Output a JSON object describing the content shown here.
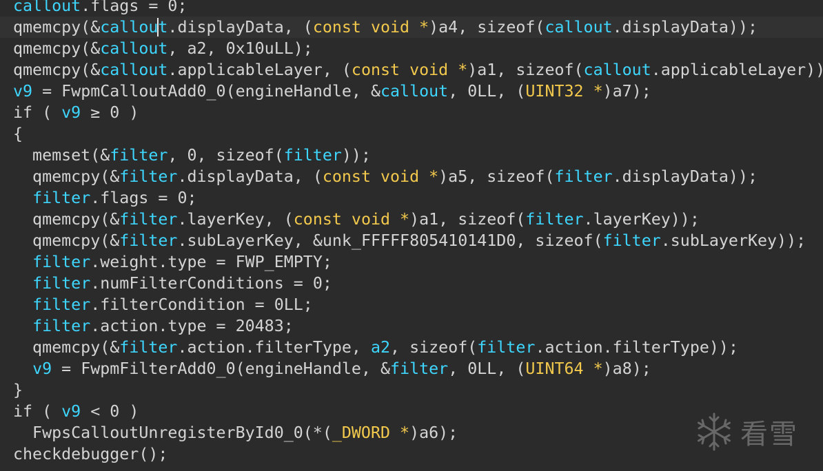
{
  "editor": {
    "lines": [
      [
        {
          "t": "callout",
          "c": "var"
        },
        {
          "t": ".flags = 0;",
          "c": "plain"
        }
      ],
      [
        {
          "t": "qmemcpy(&",
          "c": "plain"
        },
        {
          "t": "callou",
          "c": "var"
        },
        {
          "caret": true
        },
        {
          "t": "t",
          "c": "var"
        },
        {
          "t": ".displayData, (",
          "c": "plain"
        },
        {
          "t": "const void *",
          "c": "type"
        },
        {
          "t": ")a4, sizeof(",
          "c": "plain"
        },
        {
          "t": "callout",
          "c": "var"
        },
        {
          "t": ".displayData));",
          "c": "plain"
        }
      ],
      [
        {
          "t": "qmemcpy(&",
          "c": "plain"
        },
        {
          "t": "callout",
          "c": "var"
        },
        {
          "t": ", a2, 0x10uLL);",
          "c": "plain"
        }
      ],
      [
        {
          "t": "qmemcpy(&",
          "c": "plain"
        },
        {
          "t": "callout",
          "c": "var"
        },
        {
          "t": ".applicableLayer, (",
          "c": "plain"
        },
        {
          "t": "const void *",
          "c": "type"
        },
        {
          "t": ")a1, sizeof(",
          "c": "plain"
        },
        {
          "t": "callout",
          "c": "var"
        },
        {
          "t": ".applicableLayer));",
          "c": "plain"
        }
      ],
      [
        {
          "t": "v9",
          "c": "var"
        },
        {
          "t": " = FwpmCalloutAdd0_0(engineHandle, &",
          "c": "plain"
        },
        {
          "t": "callout",
          "c": "var"
        },
        {
          "t": ", 0LL, (",
          "c": "plain"
        },
        {
          "t": "UINT32 *",
          "c": "type"
        },
        {
          "t": ")a7);",
          "c": "plain"
        }
      ],
      [
        {
          "t": "if ( ",
          "c": "plain"
        },
        {
          "t": "v9",
          "c": "var"
        },
        {
          "t": " ≥ 0 )",
          "c": "plain"
        }
      ],
      [
        {
          "t": "{",
          "c": "plain"
        }
      ],
      [
        {
          "t": "  memset(&",
          "c": "plain"
        },
        {
          "t": "filter",
          "c": "var"
        },
        {
          "t": ", 0, sizeof(",
          "c": "plain"
        },
        {
          "t": "filter",
          "c": "var"
        },
        {
          "t": "));",
          "c": "plain"
        }
      ],
      [
        {
          "t": "  qmemcpy(&",
          "c": "plain"
        },
        {
          "t": "filter",
          "c": "var"
        },
        {
          "t": ".displayData, (",
          "c": "plain"
        },
        {
          "t": "const void *",
          "c": "type"
        },
        {
          "t": ")a5, sizeof(",
          "c": "plain"
        },
        {
          "t": "filter",
          "c": "var"
        },
        {
          "t": ".displayData));",
          "c": "plain"
        }
      ],
      [
        {
          "t": "  ",
          "c": "plain"
        },
        {
          "t": "filter",
          "c": "var"
        },
        {
          "t": ".flags = 0;",
          "c": "plain"
        }
      ],
      [
        {
          "t": "  qmemcpy(&",
          "c": "plain"
        },
        {
          "t": "filter",
          "c": "var"
        },
        {
          "t": ".layerKey, (",
          "c": "plain"
        },
        {
          "t": "const void *",
          "c": "type"
        },
        {
          "t": ")a1, sizeof(",
          "c": "plain"
        },
        {
          "t": "filter",
          "c": "var"
        },
        {
          "t": ".layerKey));",
          "c": "plain"
        }
      ],
      [
        {
          "t": "  qmemcpy(&",
          "c": "plain"
        },
        {
          "t": "filter",
          "c": "var"
        },
        {
          "t": ".subLayerKey, &unk_FFFFF805410141D0, sizeof(",
          "c": "plain"
        },
        {
          "t": "filter",
          "c": "var"
        },
        {
          "t": ".subLayerKey));",
          "c": "plain"
        }
      ],
      [
        {
          "t": "  ",
          "c": "plain"
        },
        {
          "t": "filter",
          "c": "var"
        },
        {
          "t": ".weight.type = FWP_EMPTY;",
          "c": "plain"
        }
      ],
      [
        {
          "t": "  ",
          "c": "plain"
        },
        {
          "t": "filter",
          "c": "var"
        },
        {
          "t": ".numFilterConditions = 0;",
          "c": "plain"
        }
      ],
      [
        {
          "t": "  ",
          "c": "plain"
        },
        {
          "t": "filter",
          "c": "var"
        },
        {
          "t": ".filterCondition = 0LL;",
          "c": "plain"
        }
      ],
      [
        {
          "t": "  ",
          "c": "plain"
        },
        {
          "t": "filter",
          "c": "var"
        },
        {
          "t": ".action.type = 20483;",
          "c": "plain"
        }
      ],
      [
        {
          "t": "  qmemcpy(&",
          "c": "plain"
        },
        {
          "t": "filter",
          "c": "var"
        },
        {
          "t": ".action.filterType, ",
          "c": "plain"
        },
        {
          "t": "a2",
          "c": "var"
        },
        {
          "t": ", sizeof(",
          "c": "plain"
        },
        {
          "t": "filter",
          "c": "var"
        },
        {
          "t": ".action.filterType));",
          "c": "plain"
        }
      ],
      [
        {
          "t": "  ",
          "c": "plain"
        },
        {
          "t": "v9",
          "c": "var"
        },
        {
          "t": " = FwpmFilterAdd0_0(engineHandle, &",
          "c": "plain"
        },
        {
          "t": "filter",
          "c": "var"
        },
        {
          "t": ", 0LL, (",
          "c": "plain"
        },
        {
          "t": "UINT64 *",
          "c": "type"
        },
        {
          "t": ")a8);",
          "c": "plain"
        }
      ],
      [
        {
          "t": "}",
          "c": "plain"
        }
      ],
      [
        {
          "t": "if ( ",
          "c": "plain"
        },
        {
          "t": "v9",
          "c": "var"
        },
        {
          "t": " < 0 )",
          "c": "plain"
        }
      ],
      [
        {
          "t": "  FwpsCalloutUnregisterById0_0(*(",
          "c": "plain"
        },
        {
          "t": "_DWORD *",
          "c": "type"
        },
        {
          "t": ")a6);",
          "c": "plain"
        }
      ],
      [
        {
          "t": "checkdebugger();",
          "c": "plain"
        }
      ]
    ],
    "current_line": 1
  },
  "watermark": {
    "text": "看雪",
    "icon": "snowflake-icon"
  },
  "colors": {
    "background": "#2b2b2b",
    "plain": "#d4d4d4",
    "variable": "#3ed6ff",
    "type": "#f2c94c"
  }
}
